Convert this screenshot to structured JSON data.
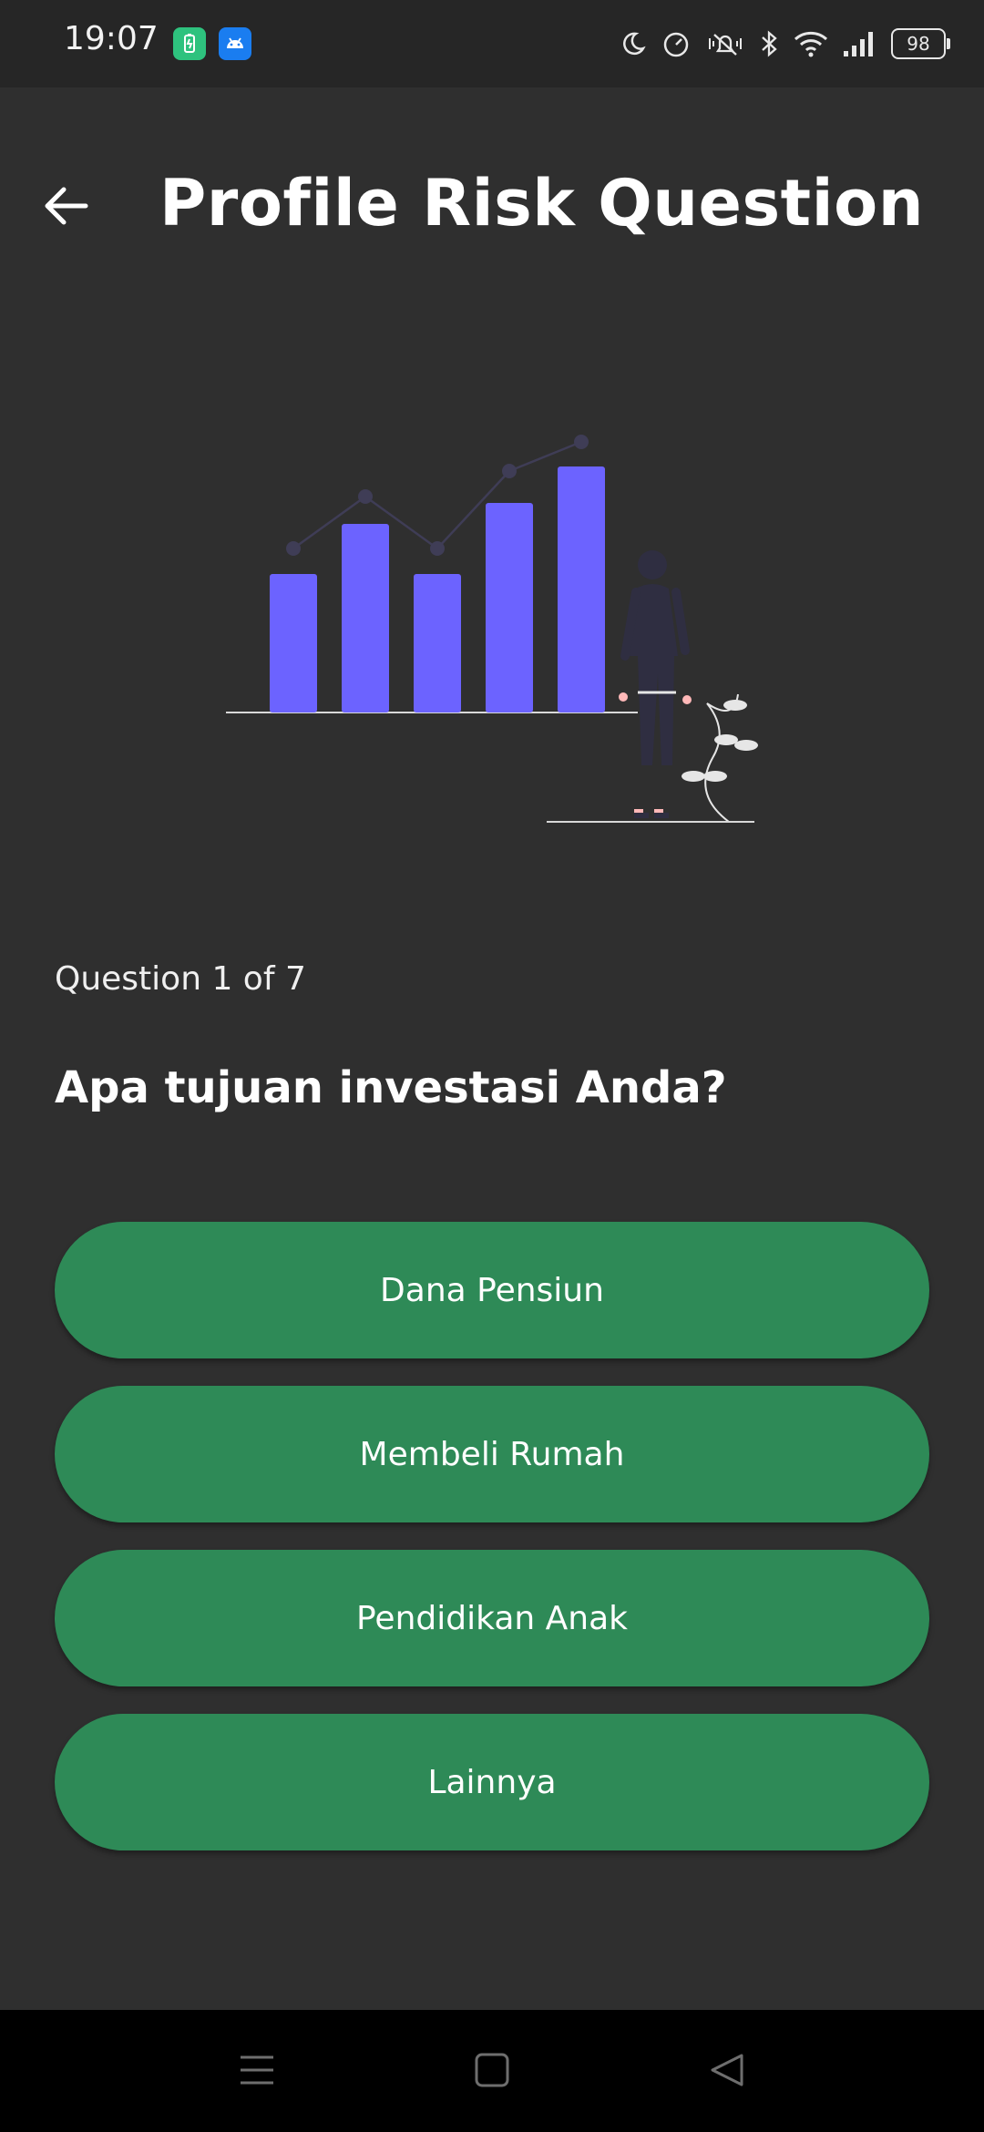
{
  "status_bar": {
    "time": "19:07",
    "battery_level": "98",
    "icons": [
      "battery-saver-icon",
      "android-icon",
      "moon-icon",
      "speedometer-icon",
      "vibrate-off-icon",
      "bluetooth-icon",
      "wifi-icon",
      "signal-icon"
    ]
  },
  "header": {
    "title": "Profile Risk Question",
    "back_icon": "arrow-left-icon"
  },
  "illustration": {
    "name": "person-viewing-bar-chart",
    "accent_color": "#6c63ff"
  },
  "quiz": {
    "counter": "Question 1 of 7",
    "question": "Apa tujuan investasi Anda?",
    "answers": [
      "Dana Pensiun",
      "Membeli Rumah",
      "Pendidikan Anak",
      "Lainnya"
    ]
  },
  "colors": {
    "background": "#2f2f2f",
    "button": "#2e8a57",
    "status_bar": "#262626",
    "nav_bar": "#000000"
  },
  "nav_bar": {
    "items": [
      "menu-icon",
      "home-square-icon",
      "back-triangle-icon"
    ]
  }
}
